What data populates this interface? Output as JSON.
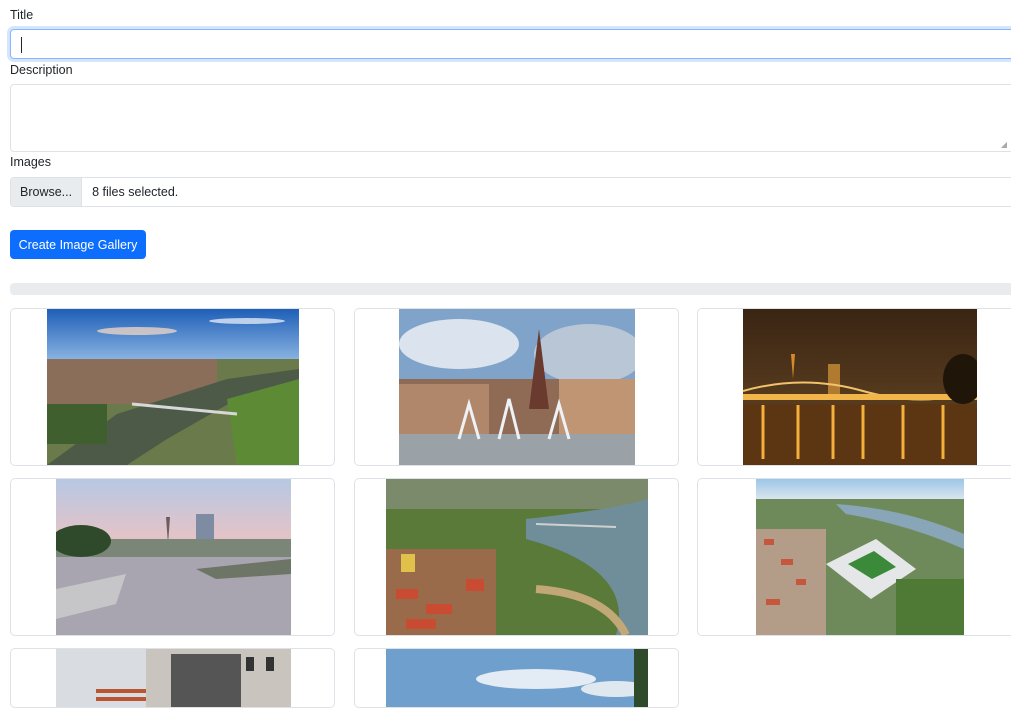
{
  "form": {
    "title_label": "Title",
    "title_value": "",
    "description_label": "Description",
    "description_value": "",
    "images_label": "Images",
    "browse_label": "Browse...",
    "files_status": "8 files selected.",
    "create_button": "Create Image Gallery"
  },
  "upload_progress": 0,
  "gallery": {
    "images": [
      {
        "name": "river-aerial-bridge"
      },
      {
        "name": "fountain-cathedral-square"
      },
      {
        "name": "night-bridge-reflections"
      },
      {
        "name": "riverfront-sunset"
      },
      {
        "name": "town-river-bend-aerial"
      },
      {
        "name": "stadium-aerial"
      },
      {
        "name": "building-facade"
      },
      {
        "name": "sky-landscape"
      }
    ]
  }
}
